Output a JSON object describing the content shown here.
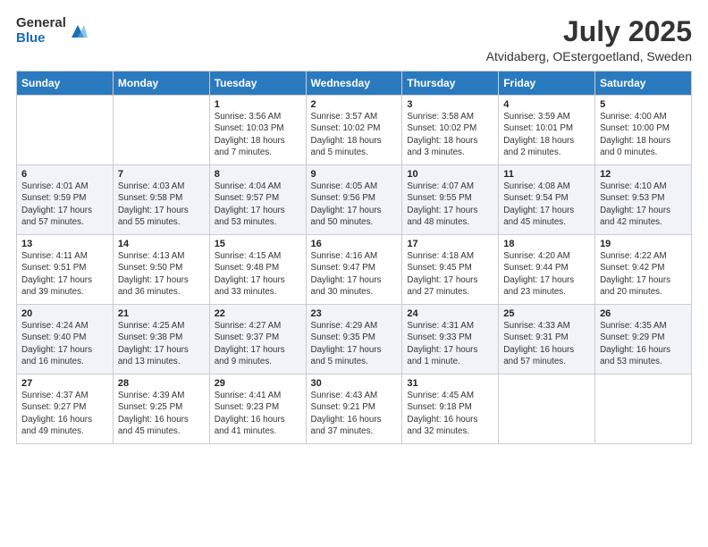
{
  "logo": {
    "general": "General",
    "blue": "Blue"
  },
  "title": {
    "month_year": "July 2025",
    "location": "Atvidaberg, OEstergoetland, Sweden"
  },
  "weekdays": [
    "Sunday",
    "Monday",
    "Tuesday",
    "Wednesday",
    "Thursday",
    "Friday",
    "Saturday"
  ],
  "weeks": [
    [
      {
        "day": "",
        "info": ""
      },
      {
        "day": "",
        "info": ""
      },
      {
        "day": "1",
        "info": "Sunrise: 3:56 AM\nSunset: 10:03 PM\nDaylight: 18 hours\nand 7 minutes."
      },
      {
        "day": "2",
        "info": "Sunrise: 3:57 AM\nSunset: 10:02 PM\nDaylight: 18 hours\nand 5 minutes."
      },
      {
        "day": "3",
        "info": "Sunrise: 3:58 AM\nSunset: 10:02 PM\nDaylight: 18 hours\nand 3 minutes."
      },
      {
        "day": "4",
        "info": "Sunrise: 3:59 AM\nSunset: 10:01 PM\nDaylight: 18 hours\nand 2 minutes."
      },
      {
        "day": "5",
        "info": "Sunrise: 4:00 AM\nSunset: 10:00 PM\nDaylight: 18 hours\nand 0 minutes."
      }
    ],
    [
      {
        "day": "6",
        "info": "Sunrise: 4:01 AM\nSunset: 9:59 PM\nDaylight: 17 hours\nand 57 minutes."
      },
      {
        "day": "7",
        "info": "Sunrise: 4:03 AM\nSunset: 9:58 PM\nDaylight: 17 hours\nand 55 minutes."
      },
      {
        "day": "8",
        "info": "Sunrise: 4:04 AM\nSunset: 9:57 PM\nDaylight: 17 hours\nand 53 minutes."
      },
      {
        "day": "9",
        "info": "Sunrise: 4:05 AM\nSunset: 9:56 PM\nDaylight: 17 hours\nand 50 minutes."
      },
      {
        "day": "10",
        "info": "Sunrise: 4:07 AM\nSunset: 9:55 PM\nDaylight: 17 hours\nand 48 minutes."
      },
      {
        "day": "11",
        "info": "Sunrise: 4:08 AM\nSunset: 9:54 PM\nDaylight: 17 hours\nand 45 minutes."
      },
      {
        "day": "12",
        "info": "Sunrise: 4:10 AM\nSunset: 9:53 PM\nDaylight: 17 hours\nand 42 minutes."
      }
    ],
    [
      {
        "day": "13",
        "info": "Sunrise: 4:11 AM\nSunset: 9:51 PM\nDaylight: 17 hours\nand 39 minutes."
      },
      {
        "day": "14",
        "info": "Sunrise: 4:13 AM\nSunset: 9:50 PM\nDaylight: 17 hours\nand 36 minutes."
      },
      {
        "day": "15",
        "info": "Sunrise: 4:15 AM\nSunset: 9:48 PM\nDaylight: 17 hours\nand 33 minutes."
      },
      {
        "day": "16",
        "info": "Sunrise: 4:16 AM\nSunset: 9:47 PM\nDaylight: 17 hours\nand 30 minutes."
      },
      {
        "day": "17",
        "info": "Sunrise: 4:18 AM\nSunset: 9:45 PM\nDaylight: 17 hours\nand 27 minutes."
      },
      {
        "day": "18",
        "info": "Sunrise: 4:20 AM\nSunset: 9:44 PM\nDaylight: 17 hours\nand 23 minutes."
      },
      {
        "day": "19",
        "info": "Sunrise: 4:22 AM\nSunset: 9:42 PM\nDaylight: 17 hours\nand 20 minutes."
      }
    ],
    [
      {
        "day": "20",
        "info": "Sunrise: 4:24 AM\nSunset: 9:40 PM\nDaylight: 17 hours\nand 16 minutes."
      },
      {
        "day": "21",
        "info": "Sunrise: 4:25 AM\nSunset: 9:38 PM\nDaylight: 17 hours\nand 13 minutes."
      },
      {
        "day": "22",
        "info": "Sunrise: 4:27 AM\nSunset: 9:37 PM\nDaylight: 17 hours\nand 9 minutes."
      },
      {
        "day": "23",
        "info": "Sunrise: 4:29 AM\nSunset: 9:35 PM\nDaylight: 17 hours\nand 5 minutes."
      },
      {
        "day": "24",
        "info": "Sunrise: 4:31 AM\nSunset: 9:33 PM\nDaylight: 17 hours\nand 1 minute."
      },
      {
        "day": "25",
        "info": "Sunrise: 4:33 AM\nSunset: 9:31 PM\nDaylight: 16 hours\nand 57 minutes."
      },
      {
        "day": "26",
        "info": "Sunrise: 4:35 AM\nSunset: 9:29 PM\nDaylight: 16 hours\nand 53 minutes."
      }
    ],
    [
      {
        "day": "27",
        "info": "Sunrise: 4:37 AM\nSunset: 9:27 PM\nDaylight: 16 hours\nand 49 minutes."
      },
      {
        "day": "28",
        "info": "Sunrise: 4:39 AM\nSunset: 9:25 PM\nDaylight: 16 hours\nand 45 minutes."
      },
      {
        "day": "29",
        "info": "Sunrise: 4:41 AM\nSunset: 9:23 PM\nDaylight: 16 hours\nand 41 minutes."
      },
      {
        "day": "30",
        "info": "Sunrise: 4:43 AM\nSunset: 9:21 PM\nDaylight: 16 hours\nand 37 minutes."
      },
      {
        "day": "31",
        "info": "Sunrise: 4:45 AM\nSunset: 9:18 PM\nDaylight: 16 hours\nand 32 minutes."
      },
      {
        "day": "",
        "info": ""
      },
      {
        "day": "",
        "info": ""
      }
    ]
  ]
}
